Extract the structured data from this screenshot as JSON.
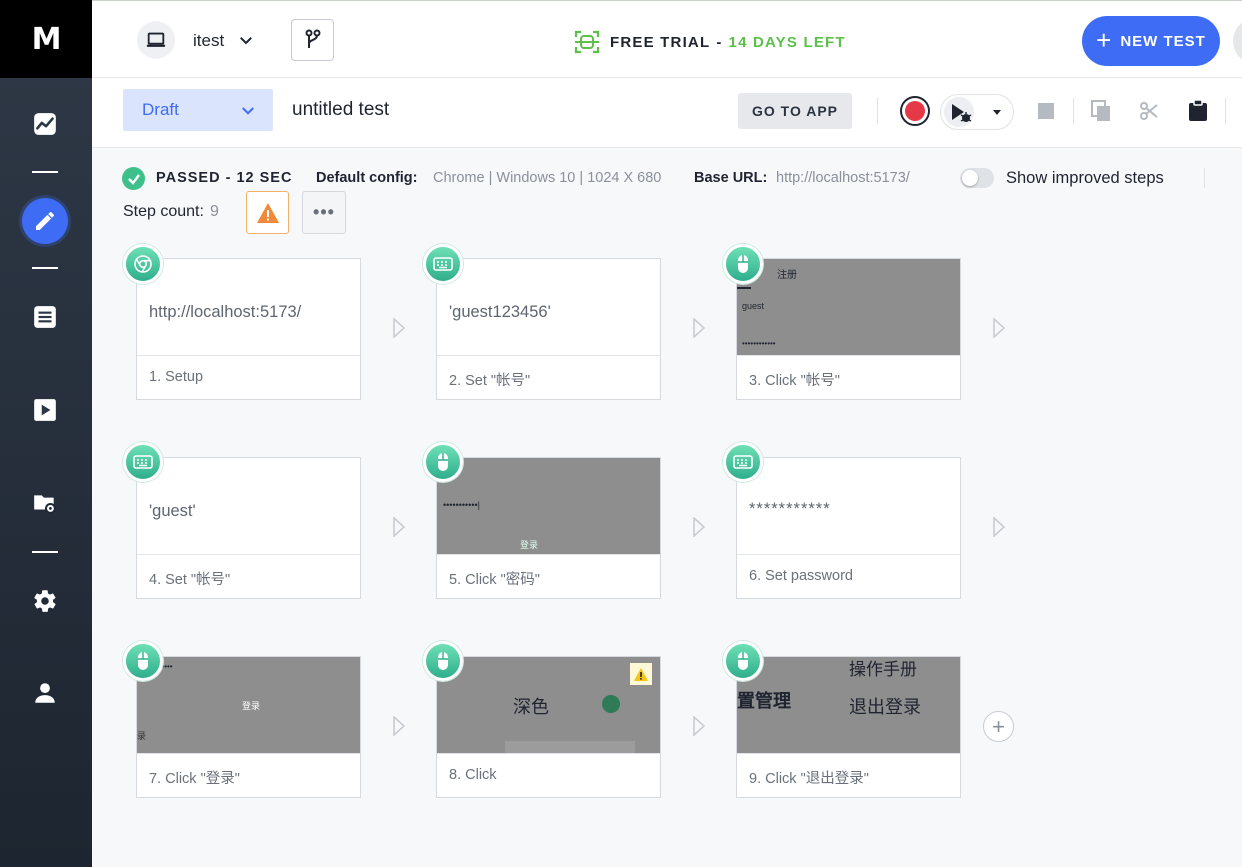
{
  "app": {
    "logo": "M"
  },
  "sidebar": {
    "items": [
      {
        "icon": "chart-icon"
      },
      {
        "icon": "pencil-icon",
        "active": true
      },
      {
        "icon": "list-icon"
      },
      {
        "icon": "play-icon"
      },
      {
        "icon": "folder-settings-icon"
      },
      {
        "icon": "gear-icon"
      },
      {
        "icon": "user-icon"
      }
    ]
  },
  "header": {
    "project": "itest",
    "trial_prefix": "FREE TRIAL",
    "trial_dash": "-",
    "trial_days": "14 DAYS LEFT",
    "new_test": "NEW TEST"
  },
  "toolbar": {
    "status": "Draft",
    "title": "untitled test",
    "go_to_app": "GO TO APP"
  },
  "summary": {
    "result": "PASSED - 12 SEC",
    "config_label": "Default config:",
    "config_value": "Chrome | Windows 10 | 1024 X 680",
    "base_url_label": "Base URL:",
    "base_url_value": "http://localhost:5173/",
    "improved_steps_label": "Show improved steps",
    "improved_steps_on": false,
    "step_count_label": "Step count:",
    "step_count": "9",
    "more_label": "•••"
  },
  "steps": [
    {
      "label": "1. Setup",
      "value": "http://localhost:5173/",
      "type": "setup",
      "icon": "chrome-icon"
    },
    {
      "label": "2. Set \"帐号\"",
      "value": "'guest123456'",
      "type": "set",
      "icon": "keyboard-icon"
    },
    {
      "label": "3. Click \"帐号\"",
      "type": "click",
      "icon": "mouse-icon",
      "shot_texts": [
        "注册",
        "guest",
        "••••••••••••"
      ]
    },
    {
      "label": "4. Set \"帐号\"",
      "value": "'guest'",
      "type": "set",
      "icon": "keyboard-icon"
    },
    {
      "label": "5. Click \"密码\"",
      "type": "click",
      "icon": "mouse-icon",
      "shot_texts": [
        "•••••••••••|",
        "登录"
      ]
    },
    {
      "label": "6. Set password",
      "value": "***********",
      "type": "set",
      "icon": "keyboard-icon"
    },
    {
      "label": "7. Click \"登录\"",
      "type": "click",
      "icon": "mouse-icon",
      "shot_texts": [
        "••••••••••••",
        "登录",
        "录"
      ]
    },
    {
      "label": "8. Click",
      "type": "click",
      "icon": "mouse-icon",
      "warning": true,
      "shot_texts": [
        "深色"
      ]
    },
    {
      "label": "9. Click \"退出登录\"",
      "type": "click",
      "icon": "mouse-icon",
      "shot_texts": [
        "操作手册",
        "置管理",
        "退出登录"
      ]
    }
  ],
  "add_step": "+",
  "colors": {
    "accent": "#3f6cf5",
    "success": "#3ec08c",
    "trial_green": "#5cc04a",
    "record_red": "#e53947",
    "warning": "#f08a3a"
  }
}
